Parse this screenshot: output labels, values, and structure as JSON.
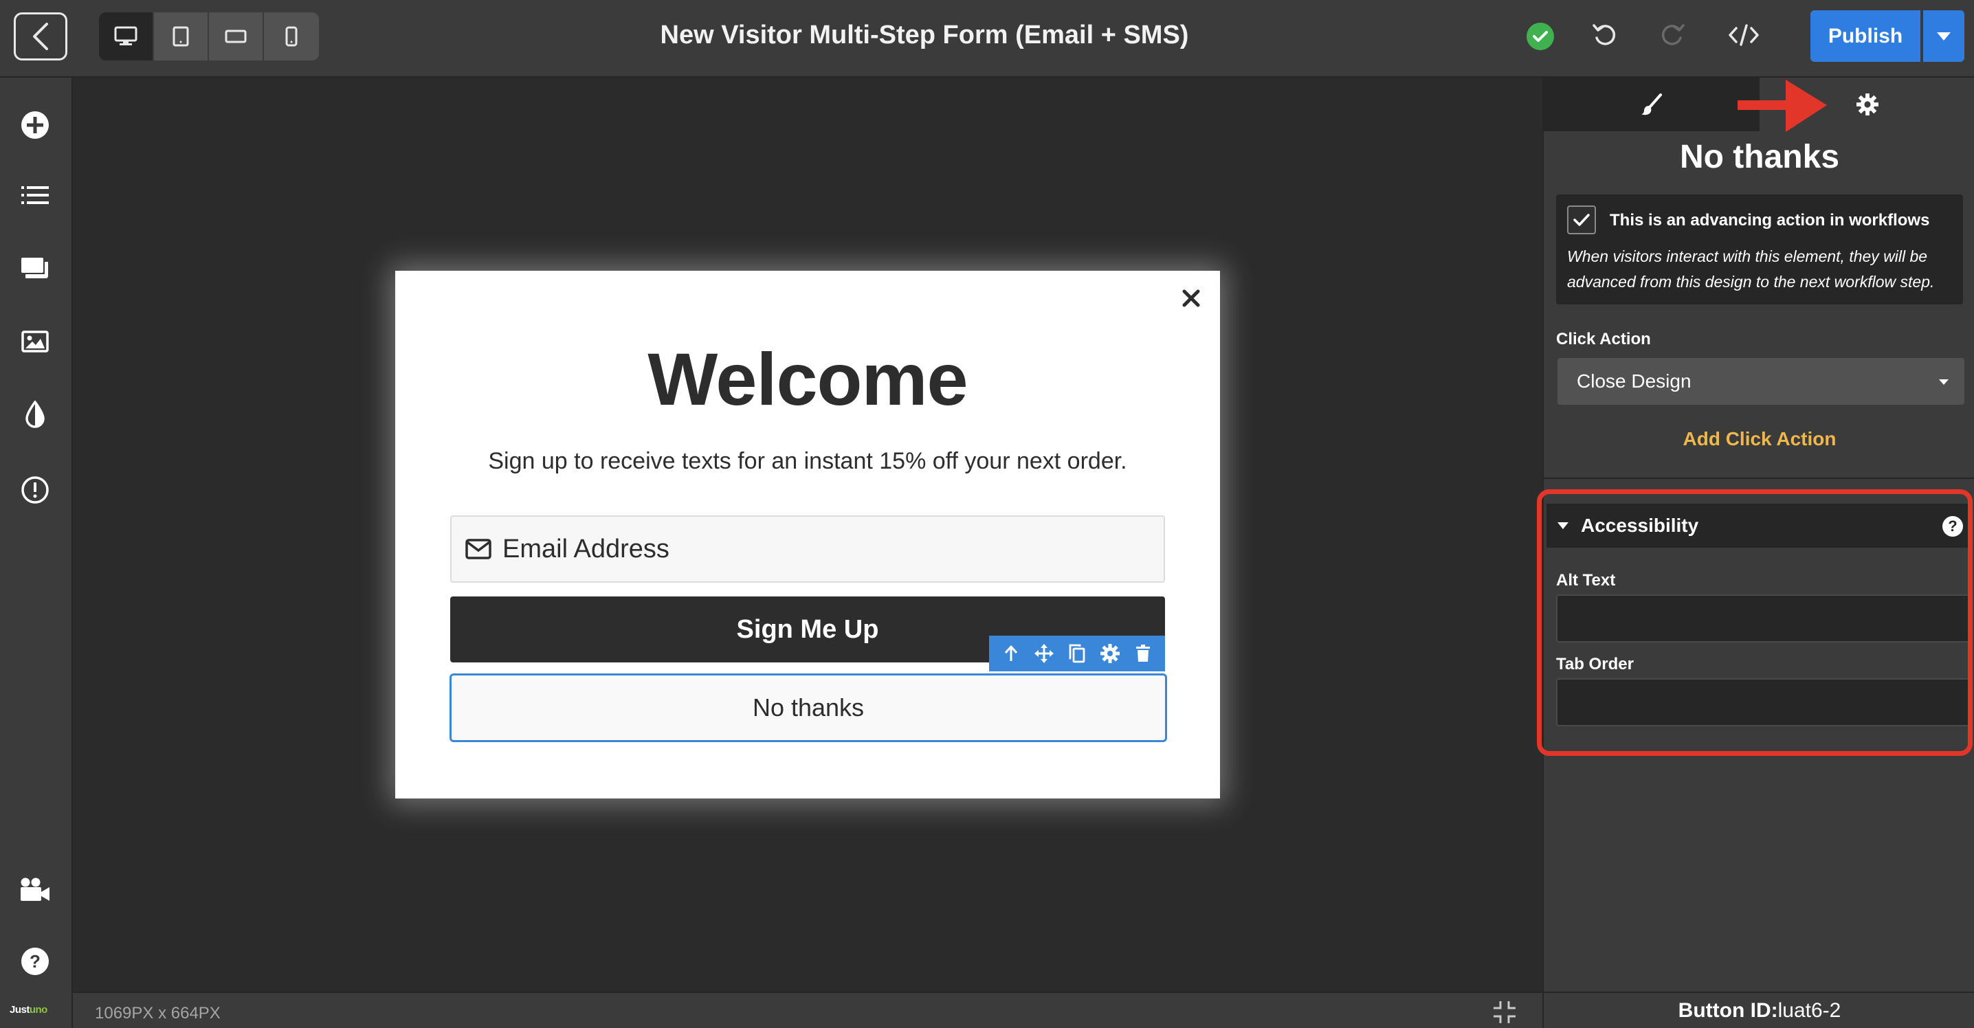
{
  "topbar": {
    "title": "New Visitor Multi-Step Form (Email + SMS)",
    "publish_label": "Publish",
    "devices": [
      "desktop-icon",
      "tablet-icon",
      "tablet-landscape-icon",
      "mobile-icon"
    ],
    "active_device": "desktop"
  },
  "canvas": {
    "dimensions": "1069PX x 664PX"
  },
  "popup": {
    "title": "Welcome",
    "subtitle": "Sign up to receive texts for an instant 15% off your next order.",
    "email_placeholder": "Email Address",
    "signup_label": "Sign Me Up",
    "nothanks_label": "No thanks"
  },
  "panel": {
    "element_title": "No thanks",
    "advancing_label": "This is an advancing action in workflows",
    "advancing_desc": "When visitors interact with this element, they will be advanced from this design to the next workflow step.",
    "click_action_label": "Click Action",
    "click_action_value": "Close Design",
    "add_click_action": "Add Click Action",
    "accessibility_title": "Accessibility",
    "alt_text_label": "Alt Text",
    "alt_text_value": "",
    "tab_order_label": "Tab Order",
    "tab_order_value": "",
    "footer_label": "Button ID:",
    "footer_value": "luat6-2"
  },
  "brand": {
    "name_a": "Just",
    "name_b": "uno"
  },
  "colors": {
    "accent_blue": "#2f7de1",
    "selection_blue": "#3a86d8",
    "success_green": "#3fb24f",
    "link_orange": "#f0b84a",
    "annotation_red": "#e3362b"
  }
}
